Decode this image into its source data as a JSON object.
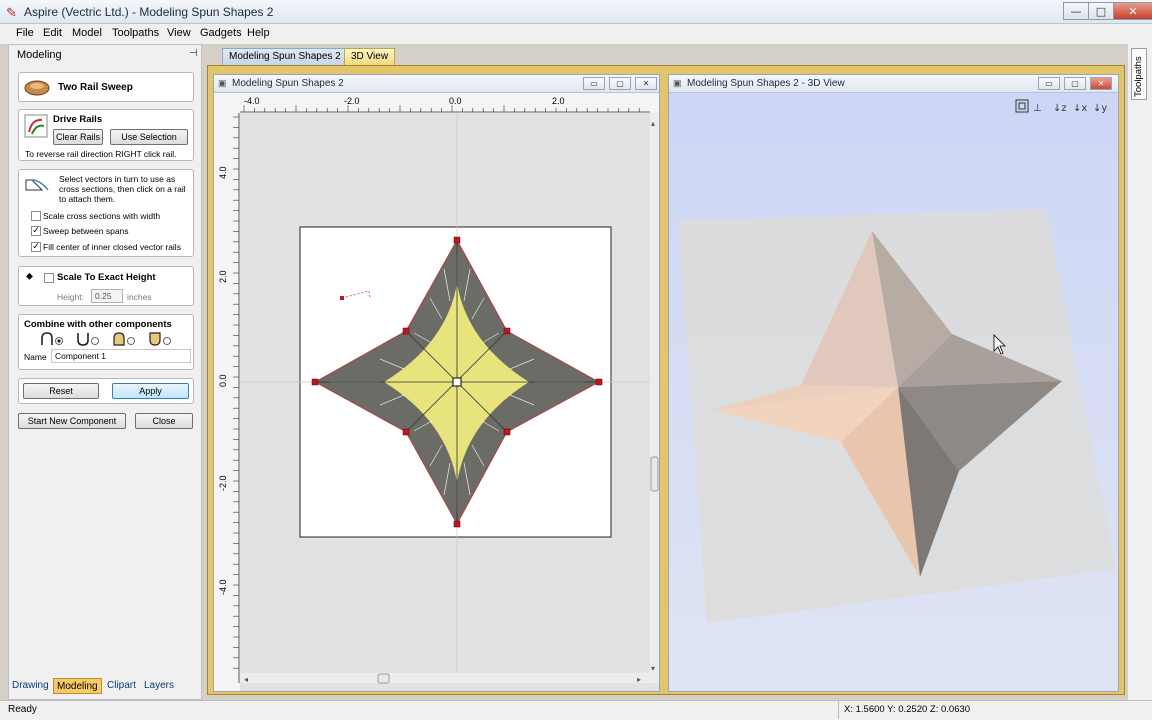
{
  "window": {
    "title": "Aspire (Vectric Ltd.) - Modeling Spun Shapes 2",
    "buttons": {
      "minimize": "—",
      "maximize": "□",
      "close": "✕"
    }
  },
  "menu": [
    "File",
    "Edit",
    "Model",
    "Toolpaths",
    "View",
    "Gadgets",
    "Help"
  ],
  "left_panel": {
    "title": "Modeling",
    "tool_name": "Two Rail Sweep",
    "drive_rails": {
      "heading": "Drive Rails",
      "clear_label": "Clear Rails",
      "use_selection_label": "Use Selection",
      "hint": "To reverse rail direction RIGHT click rail."
    },
    "cross_sections": {
      "instructions": [
        "Select vectors in turn to use as",
        "cross sections, then click on a rail",
        "to attach them."
      ],
      "options": [
        {
          "label": "Scale cross sections with width",
          "checked": false
        },
        {
          "label": "Sweep between spans",
          "checked": true
        },
        {
          "label": "Fill center of inner closed vector rails",
          "checked": true
        }
      ]
    },
    "scale": {
      "label": "Scale To Exact Height",
      "checked": false,
      "height_label": "Height:",
      "height_value": "0.25",
      "unit": "inches"
    },
    "combine": {
      "heading": "Combine with other components",
      "name_label": "Name",
      "name_value": "Component 1"
    },
    "reset_label": "Reset",
    "apply_label": "Apply",
    "start_new_label": "Start New Component",
    "close_label": "Close",
    "bottom_tabs": [
      "Drawing",
      "Modeling",
      "Clipart",
      "Layers"
    ],
    "active_tab": "Modeling"
  },
  "doc_tabs": [
    "Modeling Spun Shapes 2",
    "3D View"
  ],
  "active_doc_tab": "3D View",
  "view2d": {
    "title": "Modeling Spun Shapes 2",
    "ruler_h": [
      "-4.0",
      "-2.0",
      "0.0",
      "2.0"
    ],
    "ruler_v": [
      "4.0",
      "2.0",
      "0.0",
      "-2.0",
      "-4.0"
    ]
  },
  "view3d": {
    "title": "Modeling Spun Shapes 2 - 3D View",
    "toolbar_icons": [
      "zoom-extents-icon",
      "view-iso-icon",
      "view-top-z-icon",
      "view-x-icon",
      "view-y-icon"
    ]
  },
  "right_strip": {
    "tab_label": "Toolpaths"
  },
  "status": {
    "left": "Ready",
    "coords": "X: 1.5600 Y: 0.2520 Z: 0.0630"
  },
  "colors": {
    "workspace_border": "#e3c56b",
    "view3d_bg": "#d4dcf6",
    "star_shade": "#6a6b65",
    "star_fill": "#e8e57a",
    "node": "#c0141e"
  }
}
